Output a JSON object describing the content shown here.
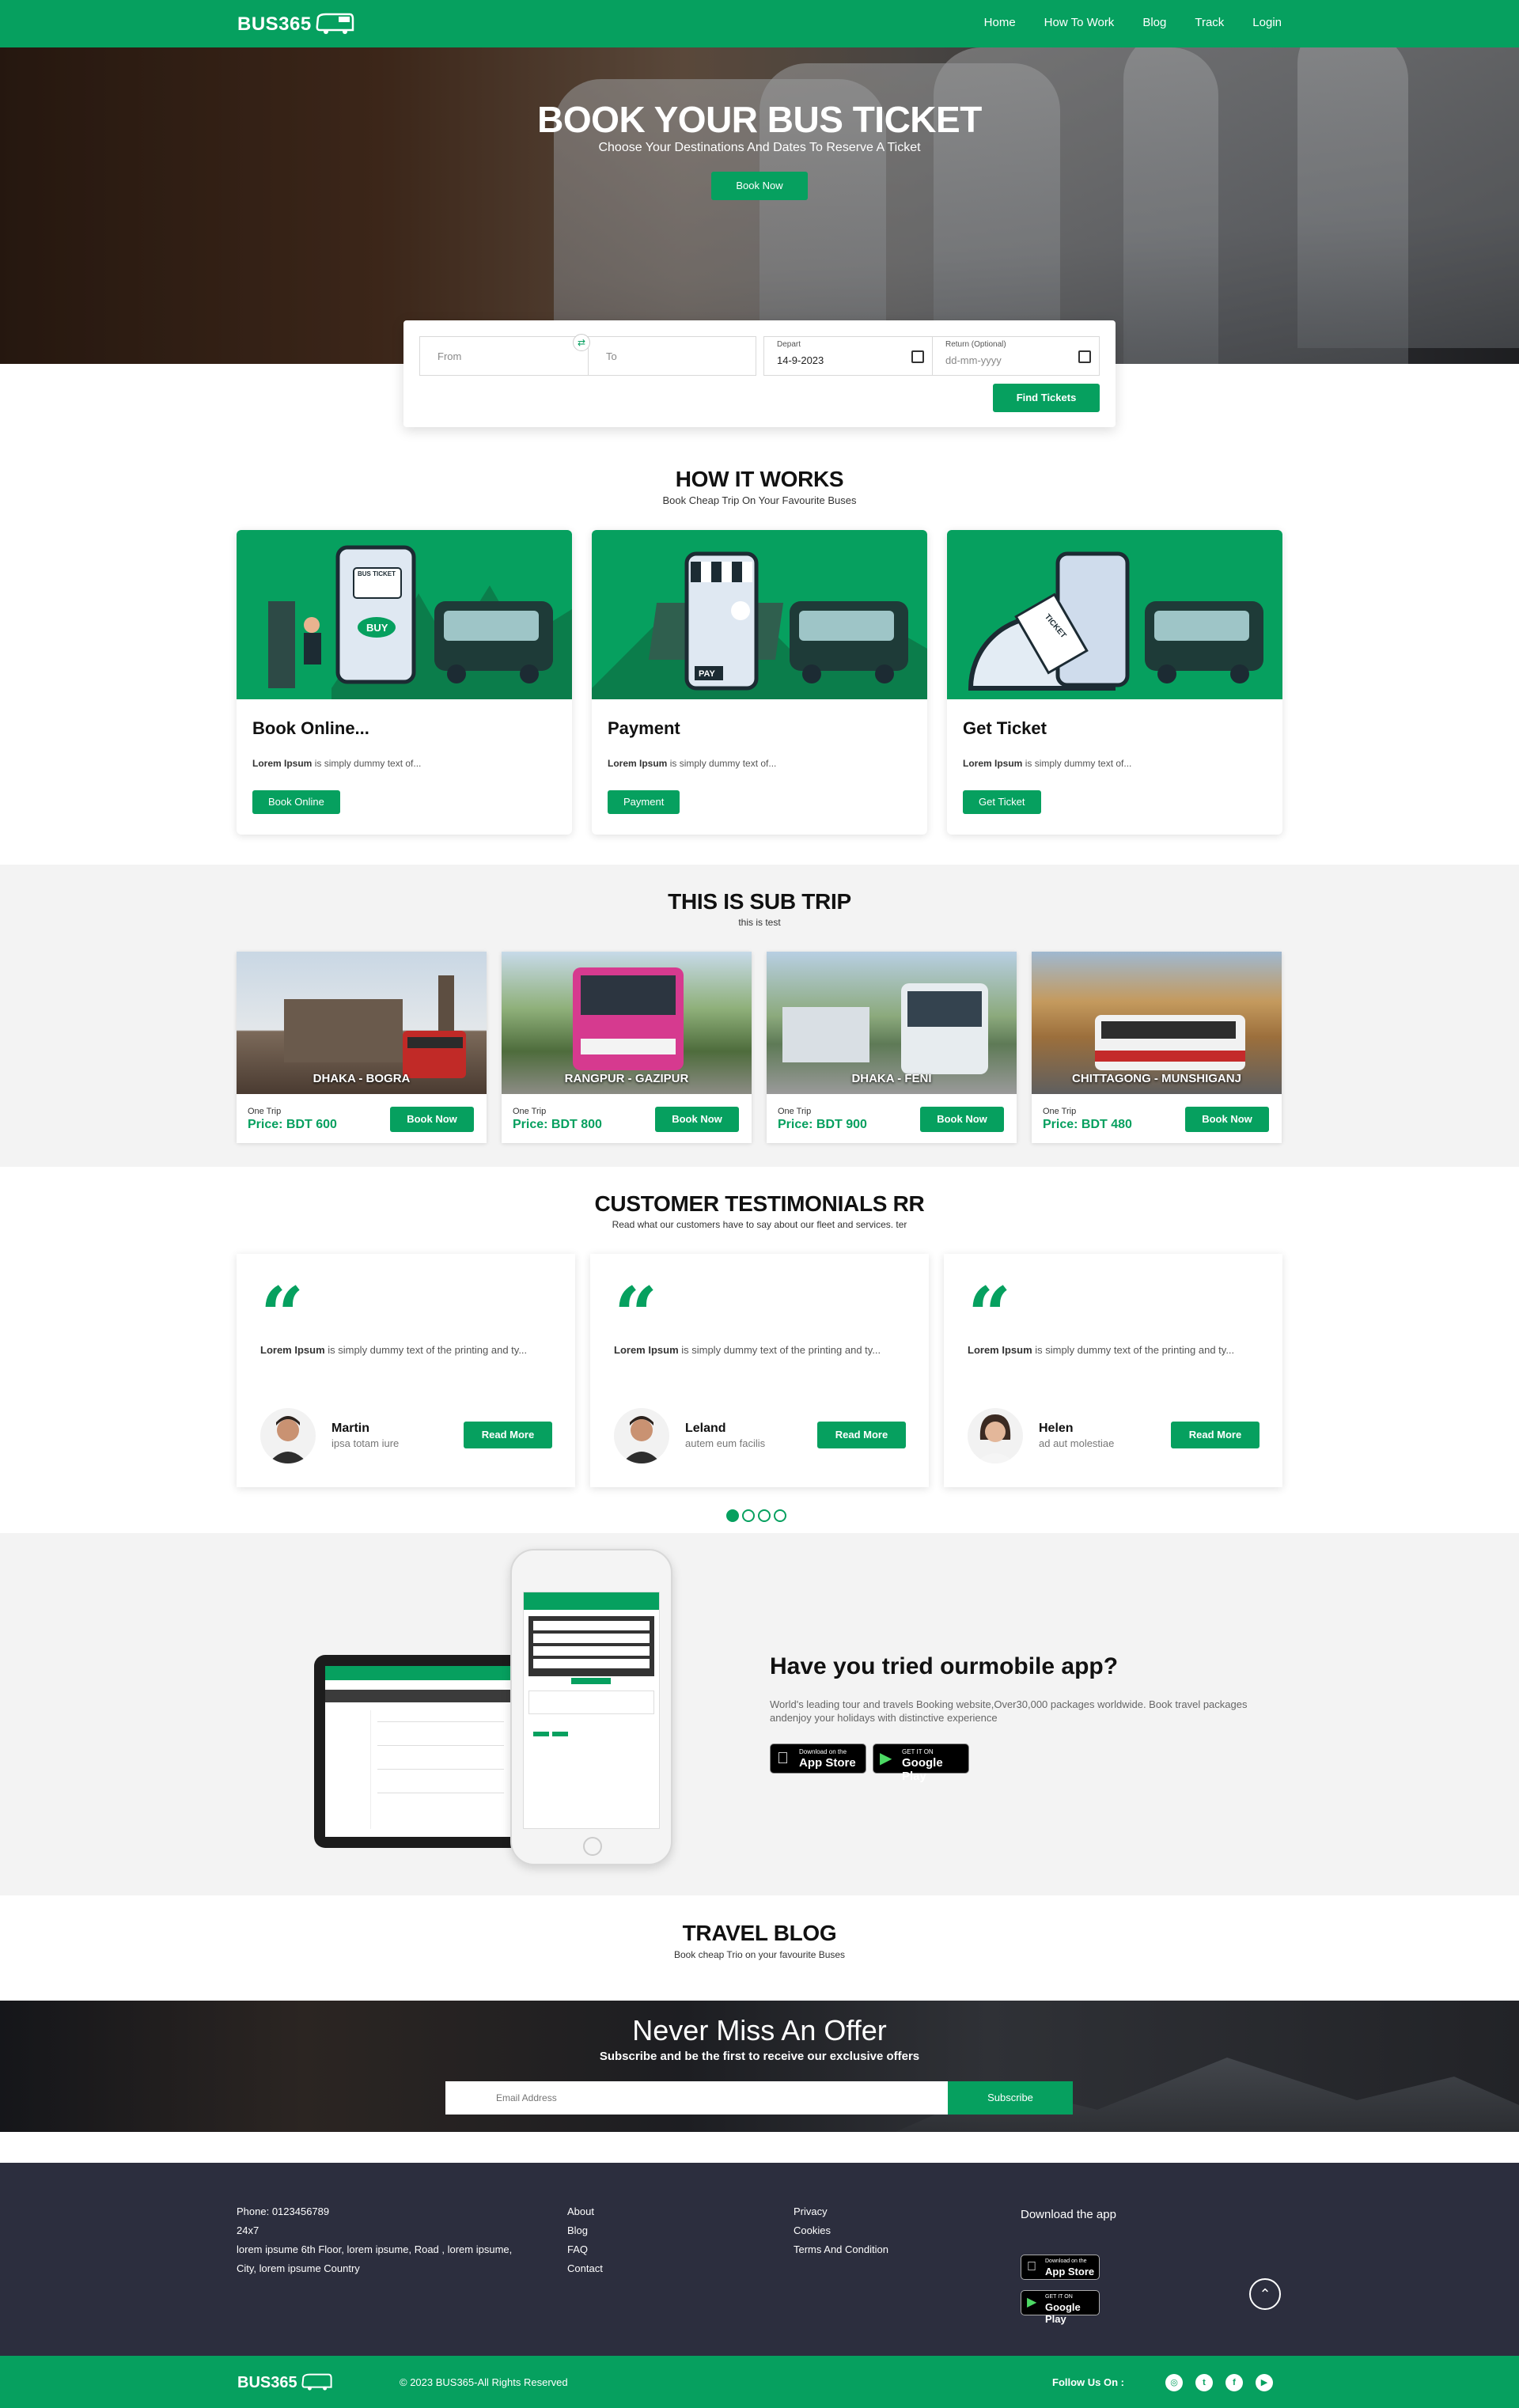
{
  "header": {
    "logo": "BUS365",
    "nav": [
      "Home",
      "How To Work",
      "Blog",
      "Track",
      "Login"
    ]
  },
  "hero": {
    "title": "BOOK YOUR BUS TICKET",
    "subtitle": "Choose Your Destinations And Dates To Reserve A Ticket",
    "button": "Book Now"
  },
  "search": {
    "from_placeholder": "From",
    "to_placeholder": "To",
    "depart_label": "Depart",
    "depart_value": "14-9-2023",
    "return_label": "Return (Optional)",
    "return_placeholder": "dd-mm-yyyy",
    "button": "Find Tickets"
  },
  "how_it_works": {
    "title": "HOW IT WORKS",
    "subtitle": "Book Cheap Trip On Your Favourite Buses",
    "cards": [
      {
        "title": "Book Online...",
        "text_bold": "Lorem Ipsum",
        "text": " is simply dummy text of...",
        "button": "Book Online",
        "img_label": "BUS TICKET",
        "img_badge": "BUY"
      },
      {
        "title": "Payment",
        "text_bold": "Lorem Ipsum",
        "text": " is simply dummy text of...",
        "button": "Payment",
        "img_label": "",
        "img_badge": "PAY"
      },
      {
        "title": "Get Ticket",
        "text_bold": "Lorem Ipsum",
        "text": " is simply dummy text of...",
        "button": "Get Ticket",
        "img_label": "TICKET",
        "img_badge": ""
      }
    ]
  },
  "sub_trip": {
    "title": "THIS IS SUB TRIP",
    "subtitle": "this is test",
    "trips": [
      {
        "route": "DHAKA - BOGRA",
        "type": "One Trip",
        "price": "Price: BDT 600",
        "button": "Book Now"
      },
      {
        "route": "RANGPUR - GAZIPUR",
        "type": "One Trip",
        "price": "Price: BDT 800",
        "button": "Book Now"
      },
      {
        "route": "DHAKA - FENI",
        "type": "One Trip",
        "price": "Price: BDT 900",
        "button": "Book Now"
      },
      {
        "route": "CHITTAGONG - MUNSHIGANJ",
        "type": "One Trip",
        "price": "Price: BDT 480",
        "button": "Book Now"
      }
    ]
  },
  "testimonials": {
    "title": "CUSTOMER TESTIMONIALS RR",
    "subtitle": "Read what our customers have to say about our fleet and services. ter",
    "items": [
      {
        "text_bold": "Lorem Ipsum",
        "text": " is simply dummy text of the printing and ty...",
        "name": "Martin",
        "role": "ipsa totam iure",
        "button": "Read More"
      },
      {
        "text_bold": "Lorem Ipsum",
        "text": " is simply dummy text of the printing and ty...",
        "name": "Leland",
        "role": "autem eum facilis",
        "button": "Read More"
      },
      {
        "text_bold": "Lorem Ipsum",
        "text": " is simply dummy text of the printing and ty...",
        "name": "Helen",
        "role": "ad aut molestiae",
        "button": "Read More"
      }
    ]
  },
  "app": {
    "title": "Have you tried ourmobile app?",
    "description": "World's leading tour and travels Booking website,Over30,000 packages worldwide. Book travel packages andenjoy your holidays with distinctive experience",
    "appstore_small": "Download on the",
    "appstore": "App Store",
    "googleplay_small": "GET IT ON",
    "googleplay": "Google Play"
  },
  "blog": {
    "title": "TRAVEL BLOG",
    "subtitle": "Book cheap Trio on your favourite Buses"
  },
  "offer": {
    "title": "Never Miss An Offer",
    "subtitle": "Subscribe and be the first to receive our exclusive offers",
    "email_placeholder": "Email Address",
    "button": "Subscribe"
  },
  "footer": {
    "phone": "Phone: 0123456789",
    "hours": "24x7",
    "address": "lorem ipsume 6th Floor, lorem ipsume, Road , lorem ipsume, City, lorem ipsume Country",
    "links1": [
      "About",
      "Blog",
      "FAQ",
      "Contact"
    ],
    "links2": [
      "Privacy",
      "Cookies",
      "Terms And Condition"
    ],
    "download_title": "Download the app",
    "appstore_small": "Download on the",
    "appstore": "App Store",
    "googleplay_small": "GET IT ON",
    "googleplay": "Google Play"
  },
  "bottom": {
    "logo": "BUS365",
    "copyright": "© 2023 BUS365-All Rights Reserved",
    "follow": "Follow Us On :"
  },
  "colors": {
    "brand": "#06a05f",
    "footer": "#2c2e3e"
  },
  "icons": [
    "bus-logo-icon",
    "swap-icon",
    "calendar-icon",
    "quote-icon",
    "apple-icon",
    "google-play-icon",
    "arrow-up-icon",
    "instagram-icon",
    "twitter-icon",
    "facebook-icon",
    "youtube-icon"
  ]
}
